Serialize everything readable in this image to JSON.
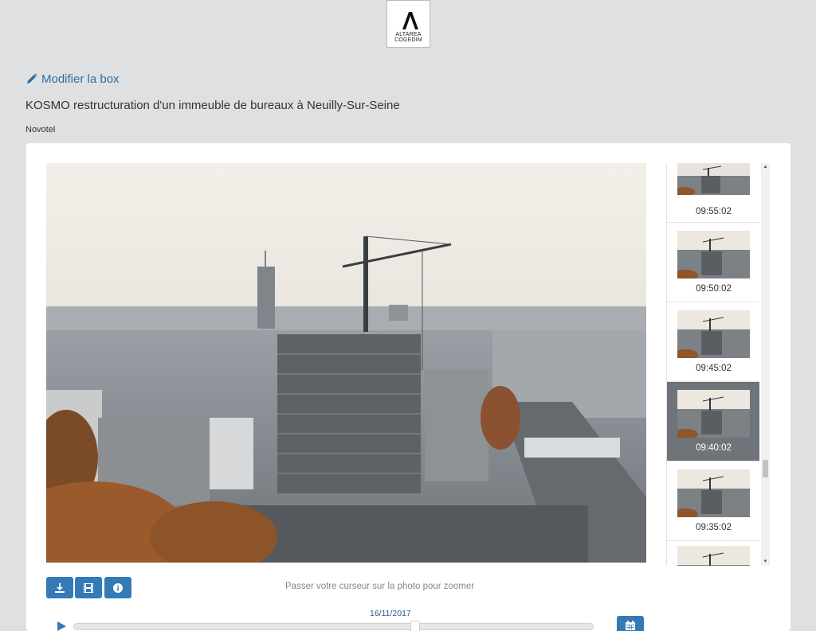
{
  "brand": {
    "logo_line1": "ALTAREA",
    "logo_line2": "COGEDIM"
  },
  "header": {
    "modify_link": "Modifier la box",
    "project_title": "KOSMO restructuration d'un immeuble de bureaux à Neuilly-Sur-Seine",
    "camera_name": "Novotel"
  },
  "viewer": {
    "zoom_hint": "Passer votre curseur sur la photo pour zoomer",
    "current_date": "16/11/2017",
    "timeline_position": 0.66,
    "buttons": {
      "download_icon": "download-icon",
      "film_icon": "film-icon",
      "info_icon": "info-icon",
      "calendar_icon": "calendar-icon"
    }
  },
  "thumbnails": [
    {
      "time": "09:55:02",
      "active": false
    },
    {
      "time": "09:50:02",
      "active": false
    },
    {
      "time": "09:45:02",
      "active": false
    },
    {
      "time": "09:40:02",
      "active": true
    },
    {
      "time": "09:35:02",
      "active": false
    },
    {
      "time": "",
      "active": false
    }
  ],
  "colors": {
    "accent": "#337ab7",
    "link": "#2f6fa3",
    "active_thumb": "#6e7479"
  }
}
